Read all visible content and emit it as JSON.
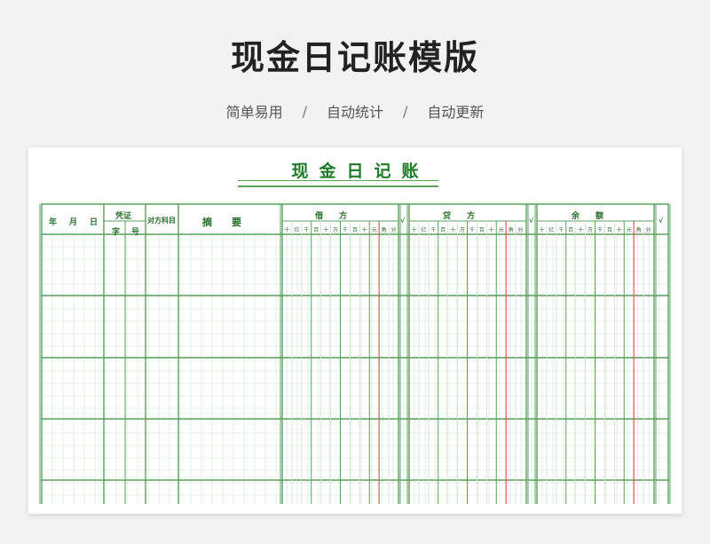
{
  "page": {
    "title": "现金日记账模版",
    "subtitle": {
      "item1": "简单易用",
      "item2": "自动统计",
      "item3": "自动更新",
      "separator": "/"
    }
  },
  "ledger": {
    "title": "现金日记账",
    "headers": {
      "year": "年",
      "month": "月",
      "day": "日",
      "voucher": "凭证",
      "voucher_type": "字",
      "voucher_number": "号",
      "contra_account": "对方科目",
      "summary": "摘　　要",
      "debit": "借　　方",
      "credit": "贷　　方",
      "balance": "余　　额",
      "check": "√"
    },
    "digit_labels": [
      "十",
      "亿",
      "千",
      "百",
      "十",
      "万",
      "千",
      "百",
      "十",
      "元",
      "角",
      "分"
    ],
    "colors": {
      "grid_green": "#5aa05f",
      "yuan_red": "#e05555",
      "title_green": "#1e7a2a"
    }
  }
}
